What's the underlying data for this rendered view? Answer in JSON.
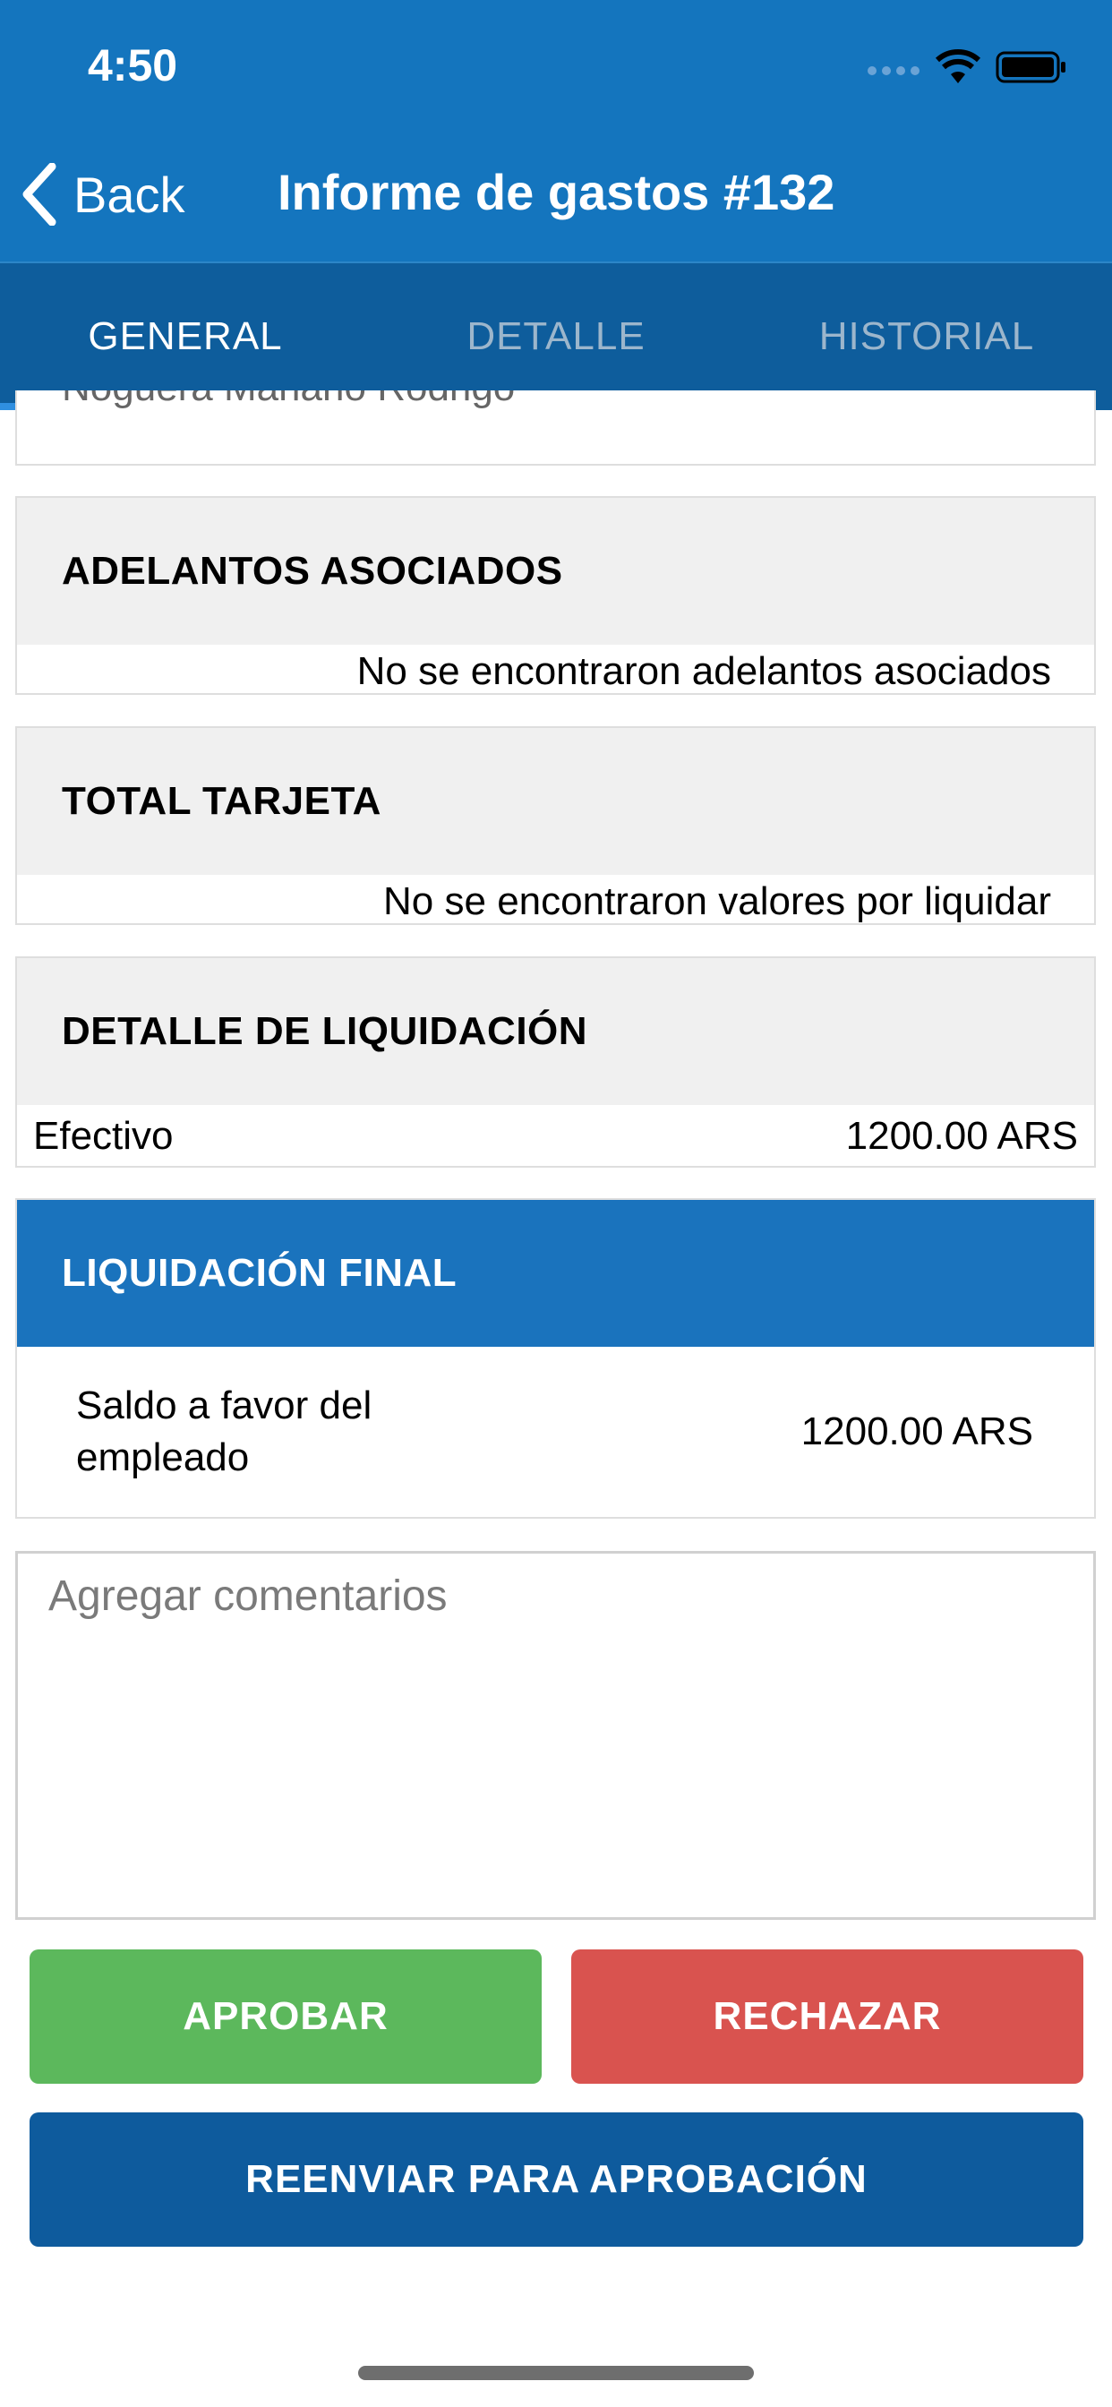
{
  "status_bar": {
    "time": "4:50"
  },
  "nav": {
    "back_label": "Back",
    "title": "Informe de gastos #132"
  },
  "tabs": [
    {
      "label": "GENERAL",
      "active": true
    },
    {
      "label": "DETALLE",
      "active": false
    },
    {
      "label": "HISTORIAL",
      "active": false
    }
  ],
  "employee_card": {
    "name_partial": "Noguera Mariano Rodrigo"
  },
  "advances": {
    "title": "ADELANTOS ASOCIADOS",
    "message": "No se encontraron adelantos asociados"
  },
  "card_total": {
    "title": "TOTAL TARJETA",
    "message": "No se encontraron valores por liquidar"
  },
  "settlement_detail": {
    "title": "DETALLE DE LIQUIDACIÓN",
    "row_label": "Efectivo",
    "row_value": "1200.00 ARS"
  },
  "final_settlement": {
    "title": "LIQUIDACIÓN FINAL",
    "row_label": "Saldo a favor del empleado",
    "row_value": "1200.00 ARS"
  },
  "comments": {
    "placeholder": "Agregar comentarios",
    "value": ""
  },
  "actions": {
    "approve_label": "APROBAR",
    "reject_label": "RECHAZAR",
    "resend_label": "REENVIAR PARA APROBACIÓN"
  },
  "colors": {
    "header": "#1475be",
    "tabbar": "#0e5d9c",
    "final_header": "#1a73bd",
    "approve": "#5cb85c",
    "reject": "#d9534f",
    "resend": "#0e5b9d"
  }
}
